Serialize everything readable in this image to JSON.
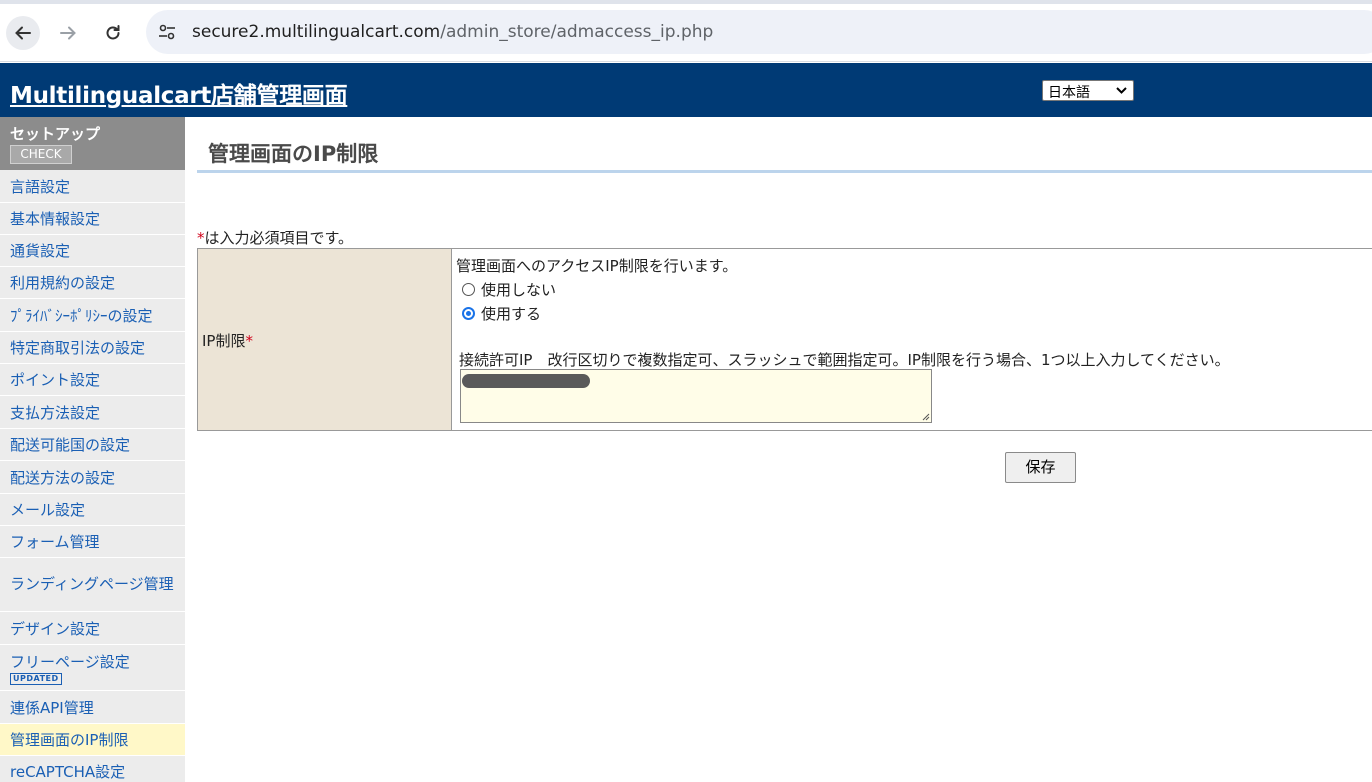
{
  "browser": {
    "url_host": "secure2.multilingualcart.com",
    "url_path": "/admin_store/admaccess_ip.php"
  },
  "header": {
    "title": "Multilingualcart店舗管理画面",
    "language": "日本語"
  },
  "sidebar": {
    "section_title": "セットアップ",
    "check_label": "CHECK",
    "items": [
      {
        "label": "言語設定"
      },
      {
        "label": "基本情報設定"
      },
      {
        "label": "通貨設定"
      },
      {
        "label": "利用規約の設定"
      },
      {
        "label": "ﾌﾟﾗｲﾊﾞｼｰﾎﾟﾘｼｰの設定"
      },
      {
        "label": "特定商取引法の設定"
      },
      {
        "label": "ポイント設定"
      },
      {
        "label": "支払方法設定"
      },
      {
        "label": "配送可能国の設定"
      },
      {
        "label": "配送方法の設定"
      },
      {
        "label": "メール設定"
      },
      {
        "label": "フォーム管理"
      },
      {
        "label": "ランディングページ管理"
      },
      {
        "label": "デザイン設定"
      },
      {
        "label": "フリーページ設定",
        "badge": "UPDATED"
      },
      {
        "label": "連係API管理"
      },
      {
        "label": "管理画面のIP制限",
        "active": true
      },
      {
        "label": "reCAPTCHA設定"
      }
    ]
  },
  "main": {
    "title": "管理画面のIP制限",
    "required_mark": "*",
    "required_note": "は入力必須項目です。",
    "field_label": "IP制限",
    "description": "管理画面へのアクセスIP制限を行います。",
    "options": [
      {
        "label": "使用しない",
        "checked": false
      },
      {
        "label": "使用する",
        "checked": true
      }
    ],
    "allow_label": "接続許可IP　改行区切りで複数指定可、スラッシュで範囲指定可。IP制限を行う場合、1つ以上入力してください。",
    "save_label": "保存"
  },
  "icons": {
    "back": "back-arrow-icon",
    "forward": "forward-arrow-icon",
    "reload": "reload-icon",
    "site_settings": "site-settings-icon",
    "select": "chevron-down-icon"
  },
  "colors": {
    "header_bg": "#003a75",
    "link": "#1a5fb4",
    "label_bg": "#ece4d6",
    "active_bg": "#fff8c8",
    "required": "#d0021b"
  }
}
